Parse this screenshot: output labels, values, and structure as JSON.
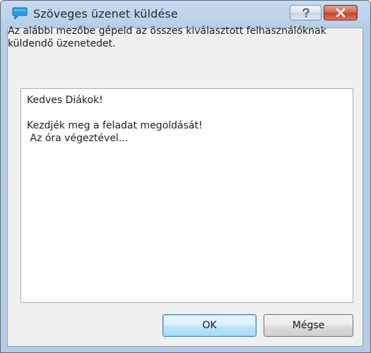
{
  "window": {
    "title": "Szöveges üzenet küldése",
    "help_label": "?",
    "close_label": "✕"
  },
  "dialog": {
    "instruction": "Az alábbi mezőbe gépeld az összes kiválasztott felhasználóknak küldendő üzenetedet.",
    "message": "Kedves Diákok!\n\nKezdjék meg a feladat megoldását!\n Az óra végeztével..."
  },
  "buttons": {
    "ok_label": "OK",
    "cancel_label": "Mégse"
  },
  "icons": {
    "app": "speech-bubble-icon",
    "help": "question-mark-icon",
    "close": "close-icon"
  },
  "colors": {
    "app_icon": "#2e9be0",
    "close_button": "#c84a31",
    "ok_border": "#3c7fb1"
  }
}
